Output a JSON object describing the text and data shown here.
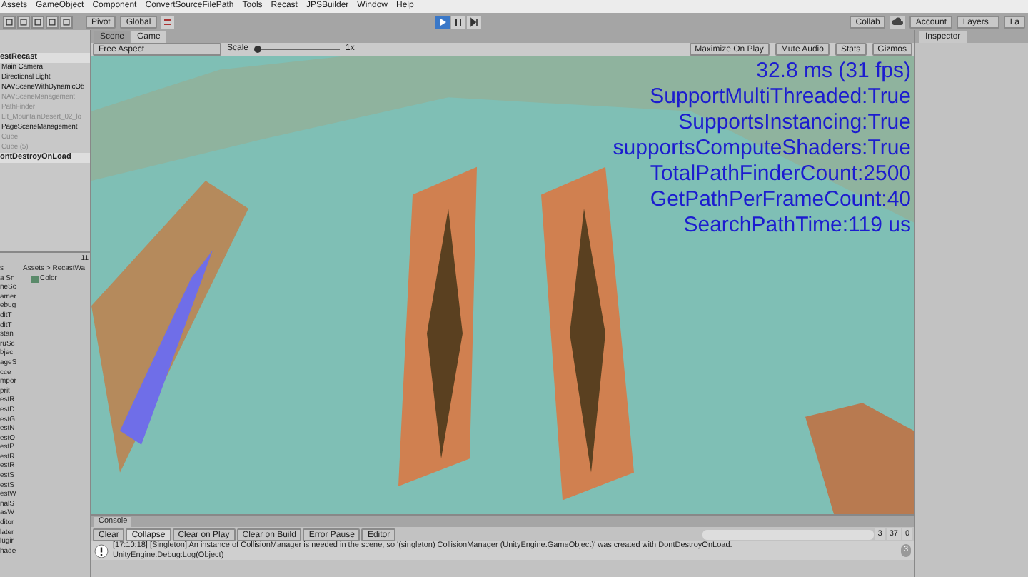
{
  "menu": [
    "Assets",
    "GameObject",
    "Component",
    "ConvertSourceFilePath",
    "Tools",
    "Recast",
    "JPSBuilder",
    "Window",
    "Help"
  ],
  "toolbar": {
    "pivot": "Pivot",
    "global": "Global",
    "play": {
      "on": true
    },
    "collab": "Collab",
    "account": "Account",
    "layers": "Layers",
    "layout": "La"
  },
  "hierarchy": {
    "items": [
      {
        "label": "estRecast",
        "kind": "scene"
      },
      {
        "label": "Main Camera",
        "kind": "object",
        "disabled": false
      },
      {
        "label": "Directional Light",
        "kind": "object",
        "disabled": false
      },
      {
        "label": "NAVSceneWithDynamicOb",
        "kind": "object",
        "disabled": false
      },
      {
        "label": "NAVSceneManagement",
        "kind": "object",
        "disabled": true
      },
      {
        "label": "PathFinder",
        "kind": "object",
        "disabled": true
      },
      {
        "label": "Lit_MountainDesert_02_lo",
        "kind": "object",
        "disabled": true
      },
      {
        "label": "PageSceneManagement",
        "kind": "object",
        "disabled": false
      },
      {
        "label": "Cube",
        "kind": "object",
        "disabled": true
      },
      {
        "label": "Cube (5)",
        "kind": "object",
        "disabled": true
      },
      {
        "label": "ontDestroyOnLoad",
        "kind": "scene"
      }
    ]
  },
  "project": {
    "count": "11",
    "breadcrumb": "Assets > RecastWa",
    "asset": "Color",
    "folders": [
      "s",
      "a Sn",
      "neSc",
      "amer",
      "ebug",
      "ditT",
      "ditT",
      "stan",
      "ruSc",
      "bjec",
      "ageS",
      "cce",
      "mpor",
      "prit",
      "estR",
      "estD",
      "estG",
      "estN",
      "estO",
      "estP",
      "estR",
      "estR",
      "estS",
      "estS",
      "estW",
      "nalS",
      "asW",
      "ditor",
      "later",
      "lugir",
      "hade"
    ]
  },
  "tabs": [
    {
      "label": "Scene",
      "selected": false
    },
    {
      "label": "Game",
      "selected": true
    }
  ],
  "game_toolbar": {
    "aspect": "Free Aspect",
    "scale_label": "Scale",
    "scale_value": "1x",
    "level": 0.0,
    "buttons": [
      "Maximize On Play",
      "Mute Audio",
      "Stats",
      "Gizmos"
    ]
  },
  "stats": [
    "32.8 ms (31 fps)",
    "SupportMultiThreaded:True",
    "SupportsInstancing:True",
    "supportsComputeShaders:True",
    "TotalPathFinderCount:2500",
    "GetPathPerFrameCount:40",
    "SearchPathTime:119 us"
  ],
  "inspector": {
    "tab": "Inspector"
  },
  "console": {
    "tab": "Console",
    "buttons": [
      {
        "label": "Clear",
        "selected": false
      },
      {
        "label": "Collapse",
        "selected": true
      },
      {
        "label": "Clear on Play",
        "selected": false
      },
      {
        "label": "Clear on Build",
        "selected": false
      },
      {
        "label": "Error Pause",
        "selected": false
      }
    ],
    "editor": "Editor",
    "counts": {
      "info": "3",
      "warning": "37",
      "error": "0"
    },
    "message": {
      "line1": "[17:10:18] [Singleton] An instance of CollisionManager is needed in the scene, so '(singleton) CollisionManager (UnityEngine.GameObject)' was created with DontDestroyOnLoad.",
      "line2": "UnityEngine.Debug:Log(Object)",
      "count": "3"
    }
  }
}
